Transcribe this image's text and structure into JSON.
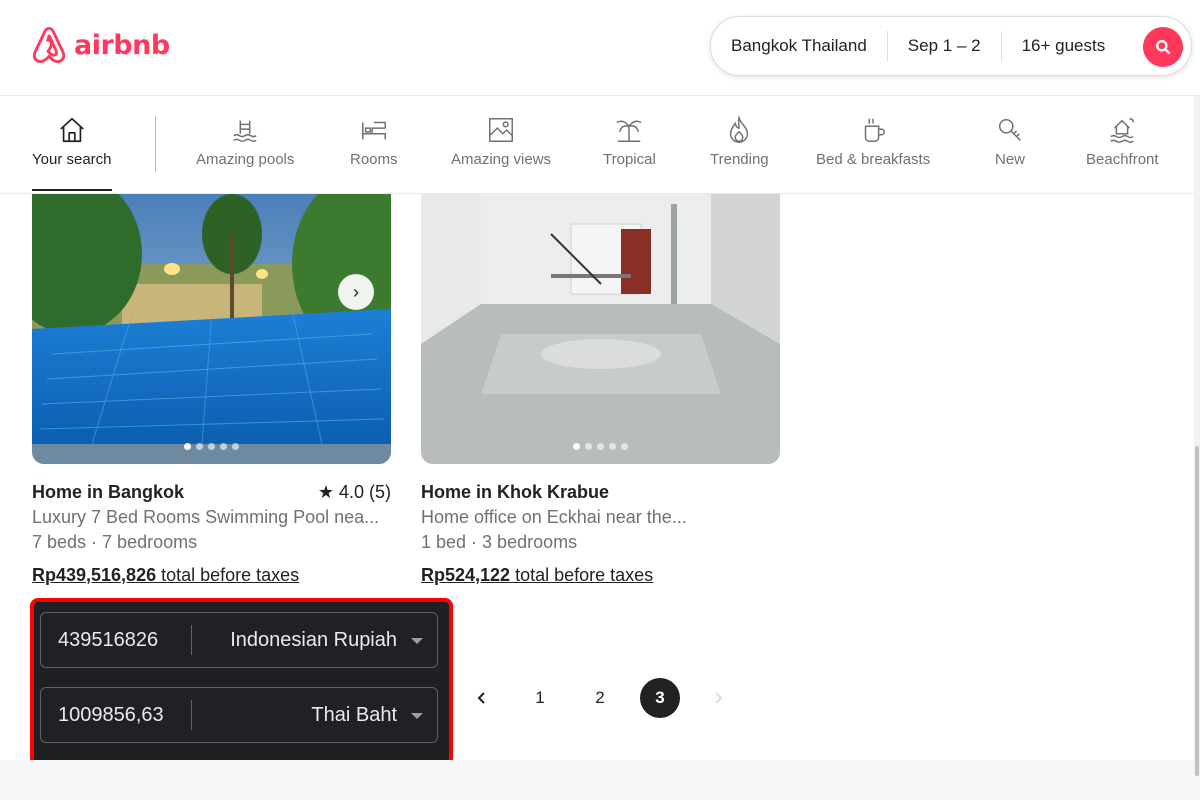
{
  "brand": {
    "name": "airbnb",
    "color": "#ff385c"
  },
  "search": {
    "location": "Bangkok Thailand",
    "dates": "Sep 1 – 2",
    "guests": "16+ guests",
    "button_icon": "search-icon"
  },
  "categories": [
    {
      "label": "Your search",
      "icon": "home-icon",
      "active": true
    },
    {
      "label": "Amazing pools",
      "icon": "pool-icon"
    },
    {
      "label": "Rooms",
      "icon": "bed-icon"
    },
    {
      "label": "Amazing views",
      "icon": "view-icon"
    },
    {
      "label": "Tropical",
      "icon": "palm-icon"
    },
    {
      "label": "Trending",
      "icon": "flame-icon"
    },
    {
      "label": "Bed & breakfasts",
      "icon": "coffee-icon"
    },
    {
      "label": "New",
      "icon": "key-icon"
    },
    {
      "label": "Beachfront",
      "icon": "beach-icon"
    }
  ],
  "listings": [
    {
      "title": "Home in Bangkok",
      "rating": "4.0 (5)",
      "description": "Luxury 7 Bed Rooms Swimming Pool nea...",
      "beds": "7 beds · 7 bedrooms",
      "price": "Rp439,516,826",
      "price_suffix": " total before taxes",
      "photo_count": 5,
      "photo_index": 1
    },
    {
      "title": "Home in Khok Krabue",
      "rating": "",
      "description": "Home office on Eckhai near the...",
      "beds": "1 bed · 3 bedrooms",
      "price": "Rp524,122",
      "price_suffix": " total before taxes",
      "photo_count": 5,
      "photo_index": 1
    }
  ],
  "converter": {
    "from": {
      "value": "439516826",
      "currency": "Indonesian Rupiah"
    },
    "to": {
      "value": "1009856,63",
      "currency": "Thai Baht"
    }
  },
  "pagination": {
    "prev_icon": "chevron-left-icon",
    "pages": [
      "1",
      "2",
      "3"
    ],
    "current": "3",
    "next_icon": "chevron-right-icon"
  }
}
